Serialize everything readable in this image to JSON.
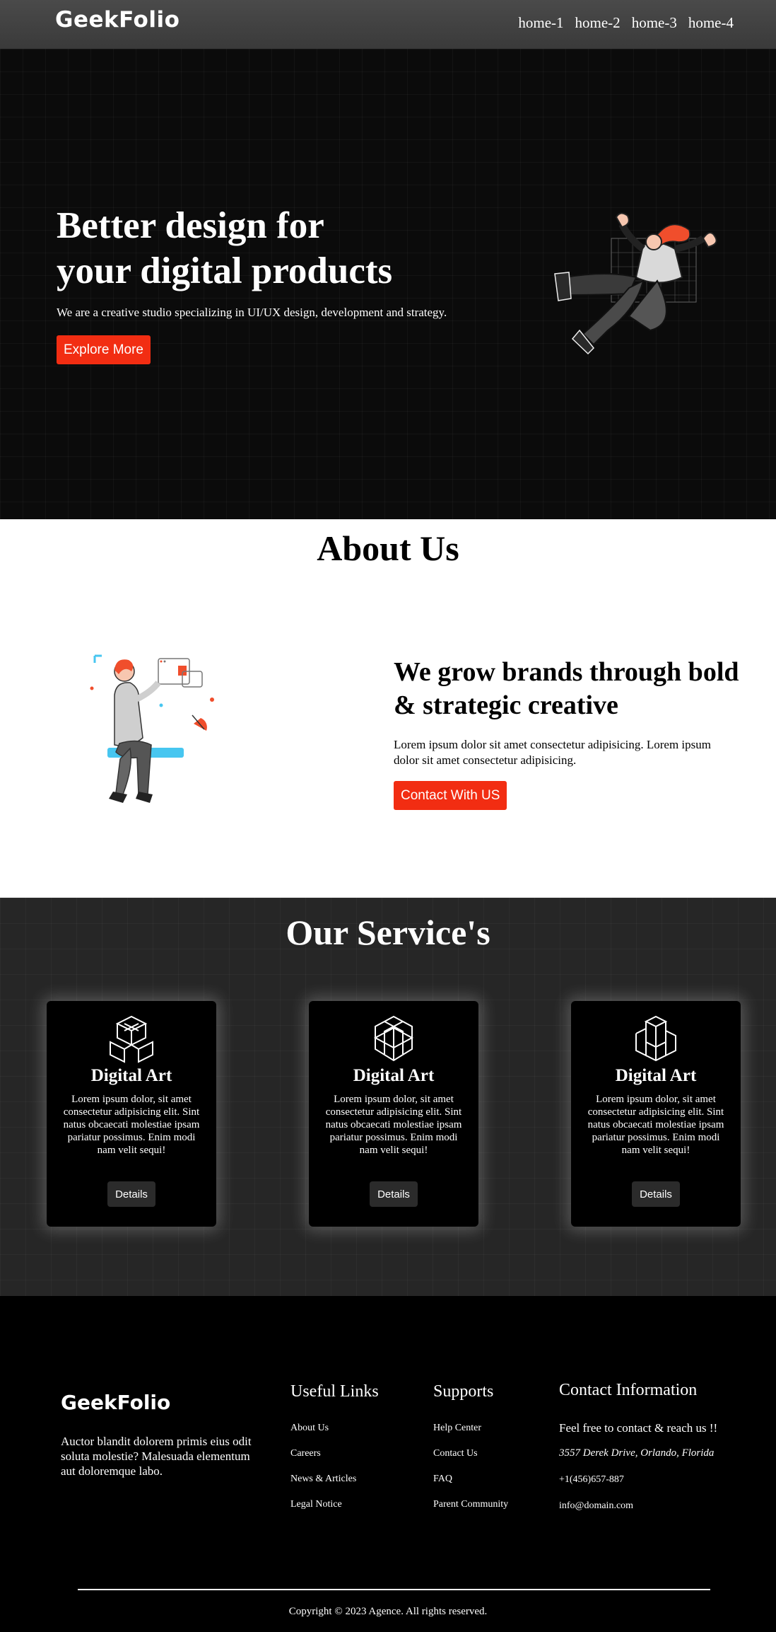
{
  "nav": {
    "logo": "GeekFolio",
    "links": [
      "home-1",
      "home-2",
      "home-3",
      "home-4"
    ]
  },
  "hero": {
    "title_line1": "Better design for",
    "title_line2": "your digital products",
    "subtitle": "We are a creative studio specializing in UI/UX design, development and strategy.",
    "button": "Explore More"
  },
  "about": {
    "title": "About Us",
    "heading": "We grow brands through bold & strategic creative",
    "text": "Lorem ipsum dolor sit amet consectetur adipisicing. Lorem ipsum dolor sit amet consectetur adipisicing.",
    "button": "Contact With US"
  },
  "services": {
    "title": "Our Service's",
    "cards": [
      {
        "icon": "cube-cluster-icon",
        "title": "Digital Art",
        "desc": "Lorem ipsum dolor, sit amet consectetur adipisicing elit. Sint natus obcaecati molestiae ipsam pariatur possimus. Enim modi nam velit sequi!",
        "button": "Details"
      },
      {
        "icon": "hexagon-lattice-icon",
        "title": "Digital Art",
        "desc": "Lorem ipsum dolor, sit amet consectetur adipisicing elit. Sint natus obcaecati molestiae ipsam pariatur possimus. Enim modi nam velit sequi!",
        "button": "Details"
      },
      {
        "icon": "stacked-boxes-icon",
        "title": "Digital Art",
        "desc": "Lorem ipsum dolor, sit amet consectetur adipisicing elit. Sint natus obcaecati molestiae ipsam pariatur possimus. Enim modi nam velit sequi!",
        "button": "Details"
      }
    ]
  },
  "footer": {
    "logo": "GeekFolio",
    "about": "Auctor blandit dolorem primis eius odit soluta molestie? Malesuada elementum aut doloremque labo.",
    "useful_links": {
      "title": "Useful Links",
      "items": [
        "About Us",
        "Careers",
        "News & Articles",
        "Legal Notice"
      ]
    },
    "supports": {
      "title": "Supports",
      "items": [
        "Help Center",
        "Contact Us",
        "FAQ",
        "Parent Community"
      ]
    },
    "contact": {
      "title": "Contact Information",
      "tagline": "Feel free to contact & reach us !!",
      "address": "3557 Derek Drive, Orlando, Florida",
      "phone": "+1(456)657-887",
      "email": "info@domain.com"
    },
    "copyright": "Copyright © 2023 Agence. All rights reserved."
  },
  "colors": {
    "accent": "#f22d12",
    "nav_bg": "#404040",
    "hero_bg": "#0b0b0b",
    "services_bg": "#262626"
  }
}
